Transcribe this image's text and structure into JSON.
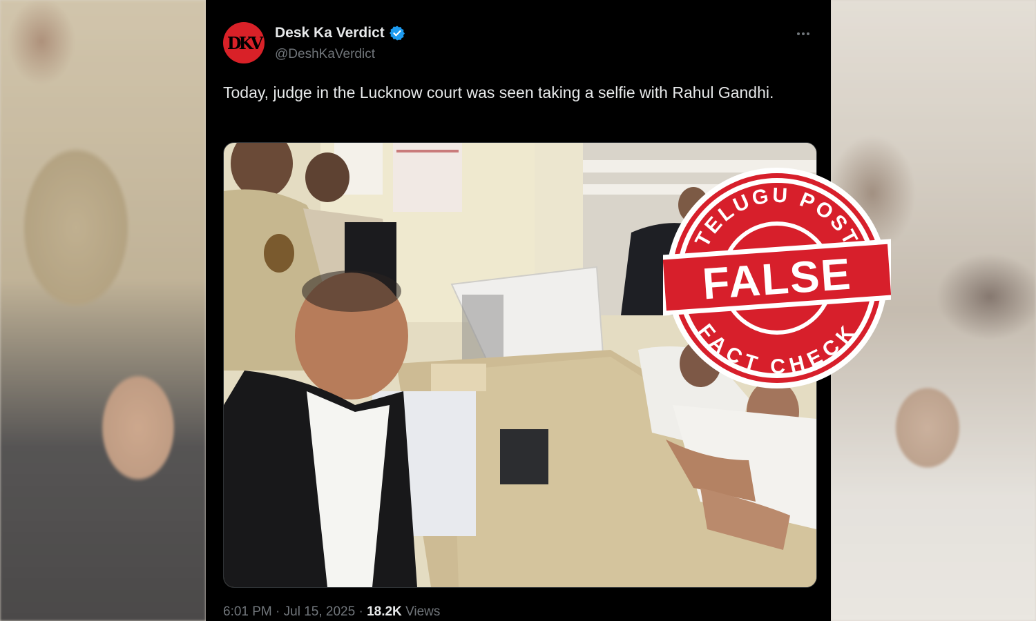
{
  "tweet": {
    "display_name": "Desk Ka Verdict",
    "handle": "@DeshKaVerdict",
    "avatar_initials": "DKV",
    "text": "Today, judge in the Lucknow court was seen taking a selfie with Rahul Gandhi.",
    "time": "6:01 PM",
    "separator": "·",
    "date": "Jul 15, 2025",
    "separator2": "·",
    "views_count": "18.2K",
    "views_label": "Views"
  },
  "stamp": {
    "top_text": "TELUGU POST",
    "verdict": "FALSE",
    "bottom_text": "FACT CHECK"
  },
  "colors": {
    "tweet_bg": "#000000",
    "text_primary": "#e7e9ea",
    "text_secondary": "#71767b",
    "verified_blue": "#1d9bf0",
    "stamp_red": "#d71f2b",
    "avatar_red": "#d92128"
  },
  "icons": [
    "verified-badge-icon",
    "more-options-icon"
  ]
}
